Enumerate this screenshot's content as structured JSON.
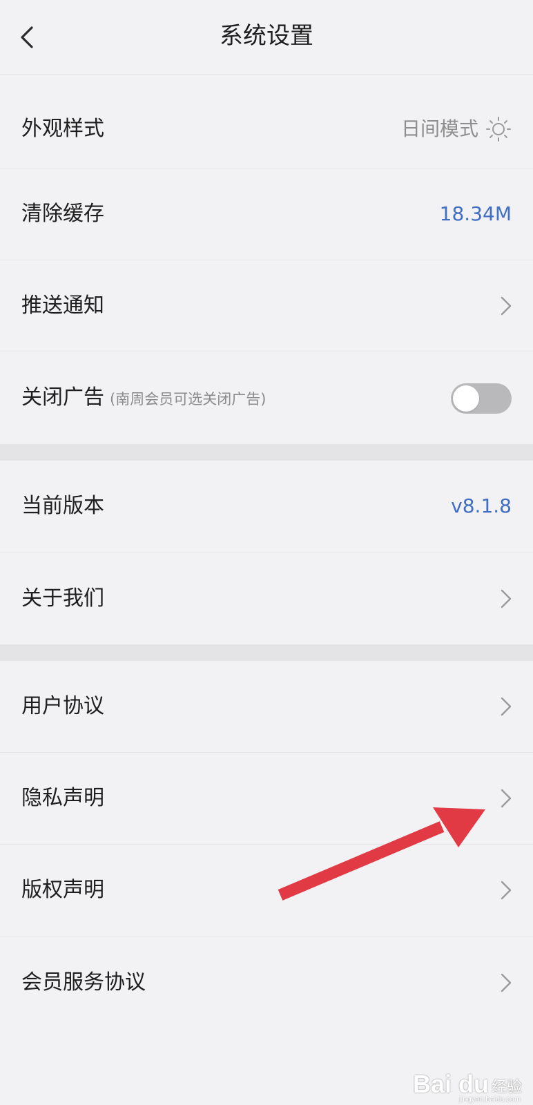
{
  "header": {
    "title": "系统设置"
  },
  "settings": {
    "appearance": {
      "label": "外观样式",
      "value": "日间模式"
    },
    "cache": {
      "label": "清除缓存",
      "value": "18.34M"
    },
    "push": {
      "label": "推送通知"
    },
    "ads": {
      "label": "关闭广告",
      "note": "(南周会员可选关闭广告)",
      "toggle_on": false
    },
    "version": {
      "label": "当前版本",
      "value": "v8.1.8"
    },
    "about": {
      "label": "关于我们"
    },
    "user_agreement": {
      "label": "用户协议"
    },
    "privacy": {
      "label": "隐私声明"
    },
    "copyright": {
      "label": "版权声明"
    },
    "member_agreement": {
      "label": "会员服务协议"
    }
  },
  "watermark": {
    "logo": "Bai du",
    "cn": "经验",
    "url": "jingyan.baidu.com"
  },
  "colors": {
    "accent_blue": "#3f6fc4",
    "annotation_red": "#e23a44",
    "background": "#f2f2f4"
  }
}
